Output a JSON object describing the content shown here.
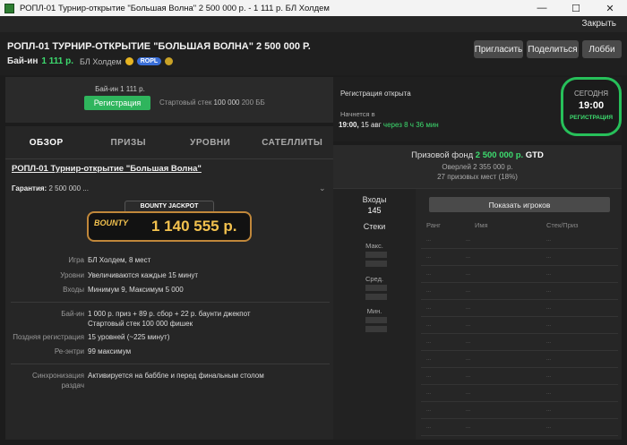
{
  "window": {
    "title": "РОПЛ-01 Турнир-открытие \"Большая Волна\" 2 500 000 р. - 1 111 р. БЛ Холдем",
    "minimize": "—",
    "maximize": "☐",
    "close": "✕",
    "close_link": "Закрыть"
  },
  "header": {
    "title": "РОПЛ-01 ТУРНИР-ОТКРЫТИЕ \"БОЛЬШАЯ ВОЛНА\" 2 500 000 Р.",
    "buyin_label": "Бай-ин",
    "buyin_value": "1 111 р.",
    "game": "БЛ Холдем",
    "badge": "ROPL",
    "buttons": {
      "invite": "Пригласить",
      "share": "Поделиться",
      "lobby": "Лобби"
    }
  },
  "register_box": {
    "buyin": "Бай-ин 1 111 р.",
    "button": "Регистрация",
    "stack_label": "Стартовый стек",
    "stack_value": "100 000",
    "stack_bb": "200 ББ"
  },
  "tabs": [
    "ОБЗОР",
    "ПРИЗЫ",
    "УРОВНИ",
    "САТЕЛЛИТЫ"
  ],
  "overview": {
    "title": "РОПЛ-01 Турнир-открытие \"Большая Волна\"",
    "guarantee_label": "Гарантия:",
    "guarantee_value": "2 500 000 ...",
    "bounty_header": "BOUNTY JACKPOT",
    "bounty_logo": "BOUNTY",
    "bounty_value": "1 140 555 р.",
    "rows": [
      {
        "label": "Игра",
        "value": "БЛ Холдем, 8 мест"
      },
      {
        "label": "Уровни",
        "value": "Увеличиваются каждые 15 минут"
      },
      {
        "label": "Входы",
        "value": "Минимум 9, Максимум 5 000"
      },
      {
        "label": "Бай-ин",
        "value": "1 000 р. приз + 89 р. сбор + 22 р. баунти джекпот"
      },
      {
        "label": "",
        "value": "Стартовый стек 100 000 фишек"
      },
      {
        "label": "Поздняя регистрация",
        "value": "15 уровней (~225 минут)"
      },
      {
        "label": "Ре-энтри",
        "value": "99 максимум"
      },
      {
        "label": "Синхронизация",
        "value": "Активируется на баббле и перед финальным столом"
      },
      {
        "label": "раздач",
        "value": ""
      }
    ]
  },
  "registration": {
    "status": "Регистрация открыта",
    "starts_label": "Начнется в",
    "time": "19:00,",
    "date": "15 авг",
    "countdown": "через 8 ч 36 мин"
  },
  "date_badge": {
    "day": "СЕГОДНЯ",
    "time": "19:00",
    "label": "РЕГИСТРАЦИЯ"
  },
  "prize_pool": {
    "label": "Призовой фонд",
    "value": "2 500 000 р.",
    "gtd": "GTD",
    "overlay": "Оверлей 2 355 000 р.",
    "places": "27 призовых мест (18%)"
  },
  "stats": {
    "entries_label": "Входы",
    "entries_value": "145",
    "stacks_label": "Стеки",
    "max": "Макс.",
    "avg": "Сред.",
    "min": "Мин."
  },
  "players": {
    "show_button": "Показать игроков",
    "columns": [
      "Ранг",
      "Имя",
      "Стек/Приз"
    ],
    "placeholder": "..."
  },
  "colors": {
    "accent_green": "#2fb55d",
    "text_green": "#3ddc6f",
    "bounty_gold": "#f2c14e"
  }
}
